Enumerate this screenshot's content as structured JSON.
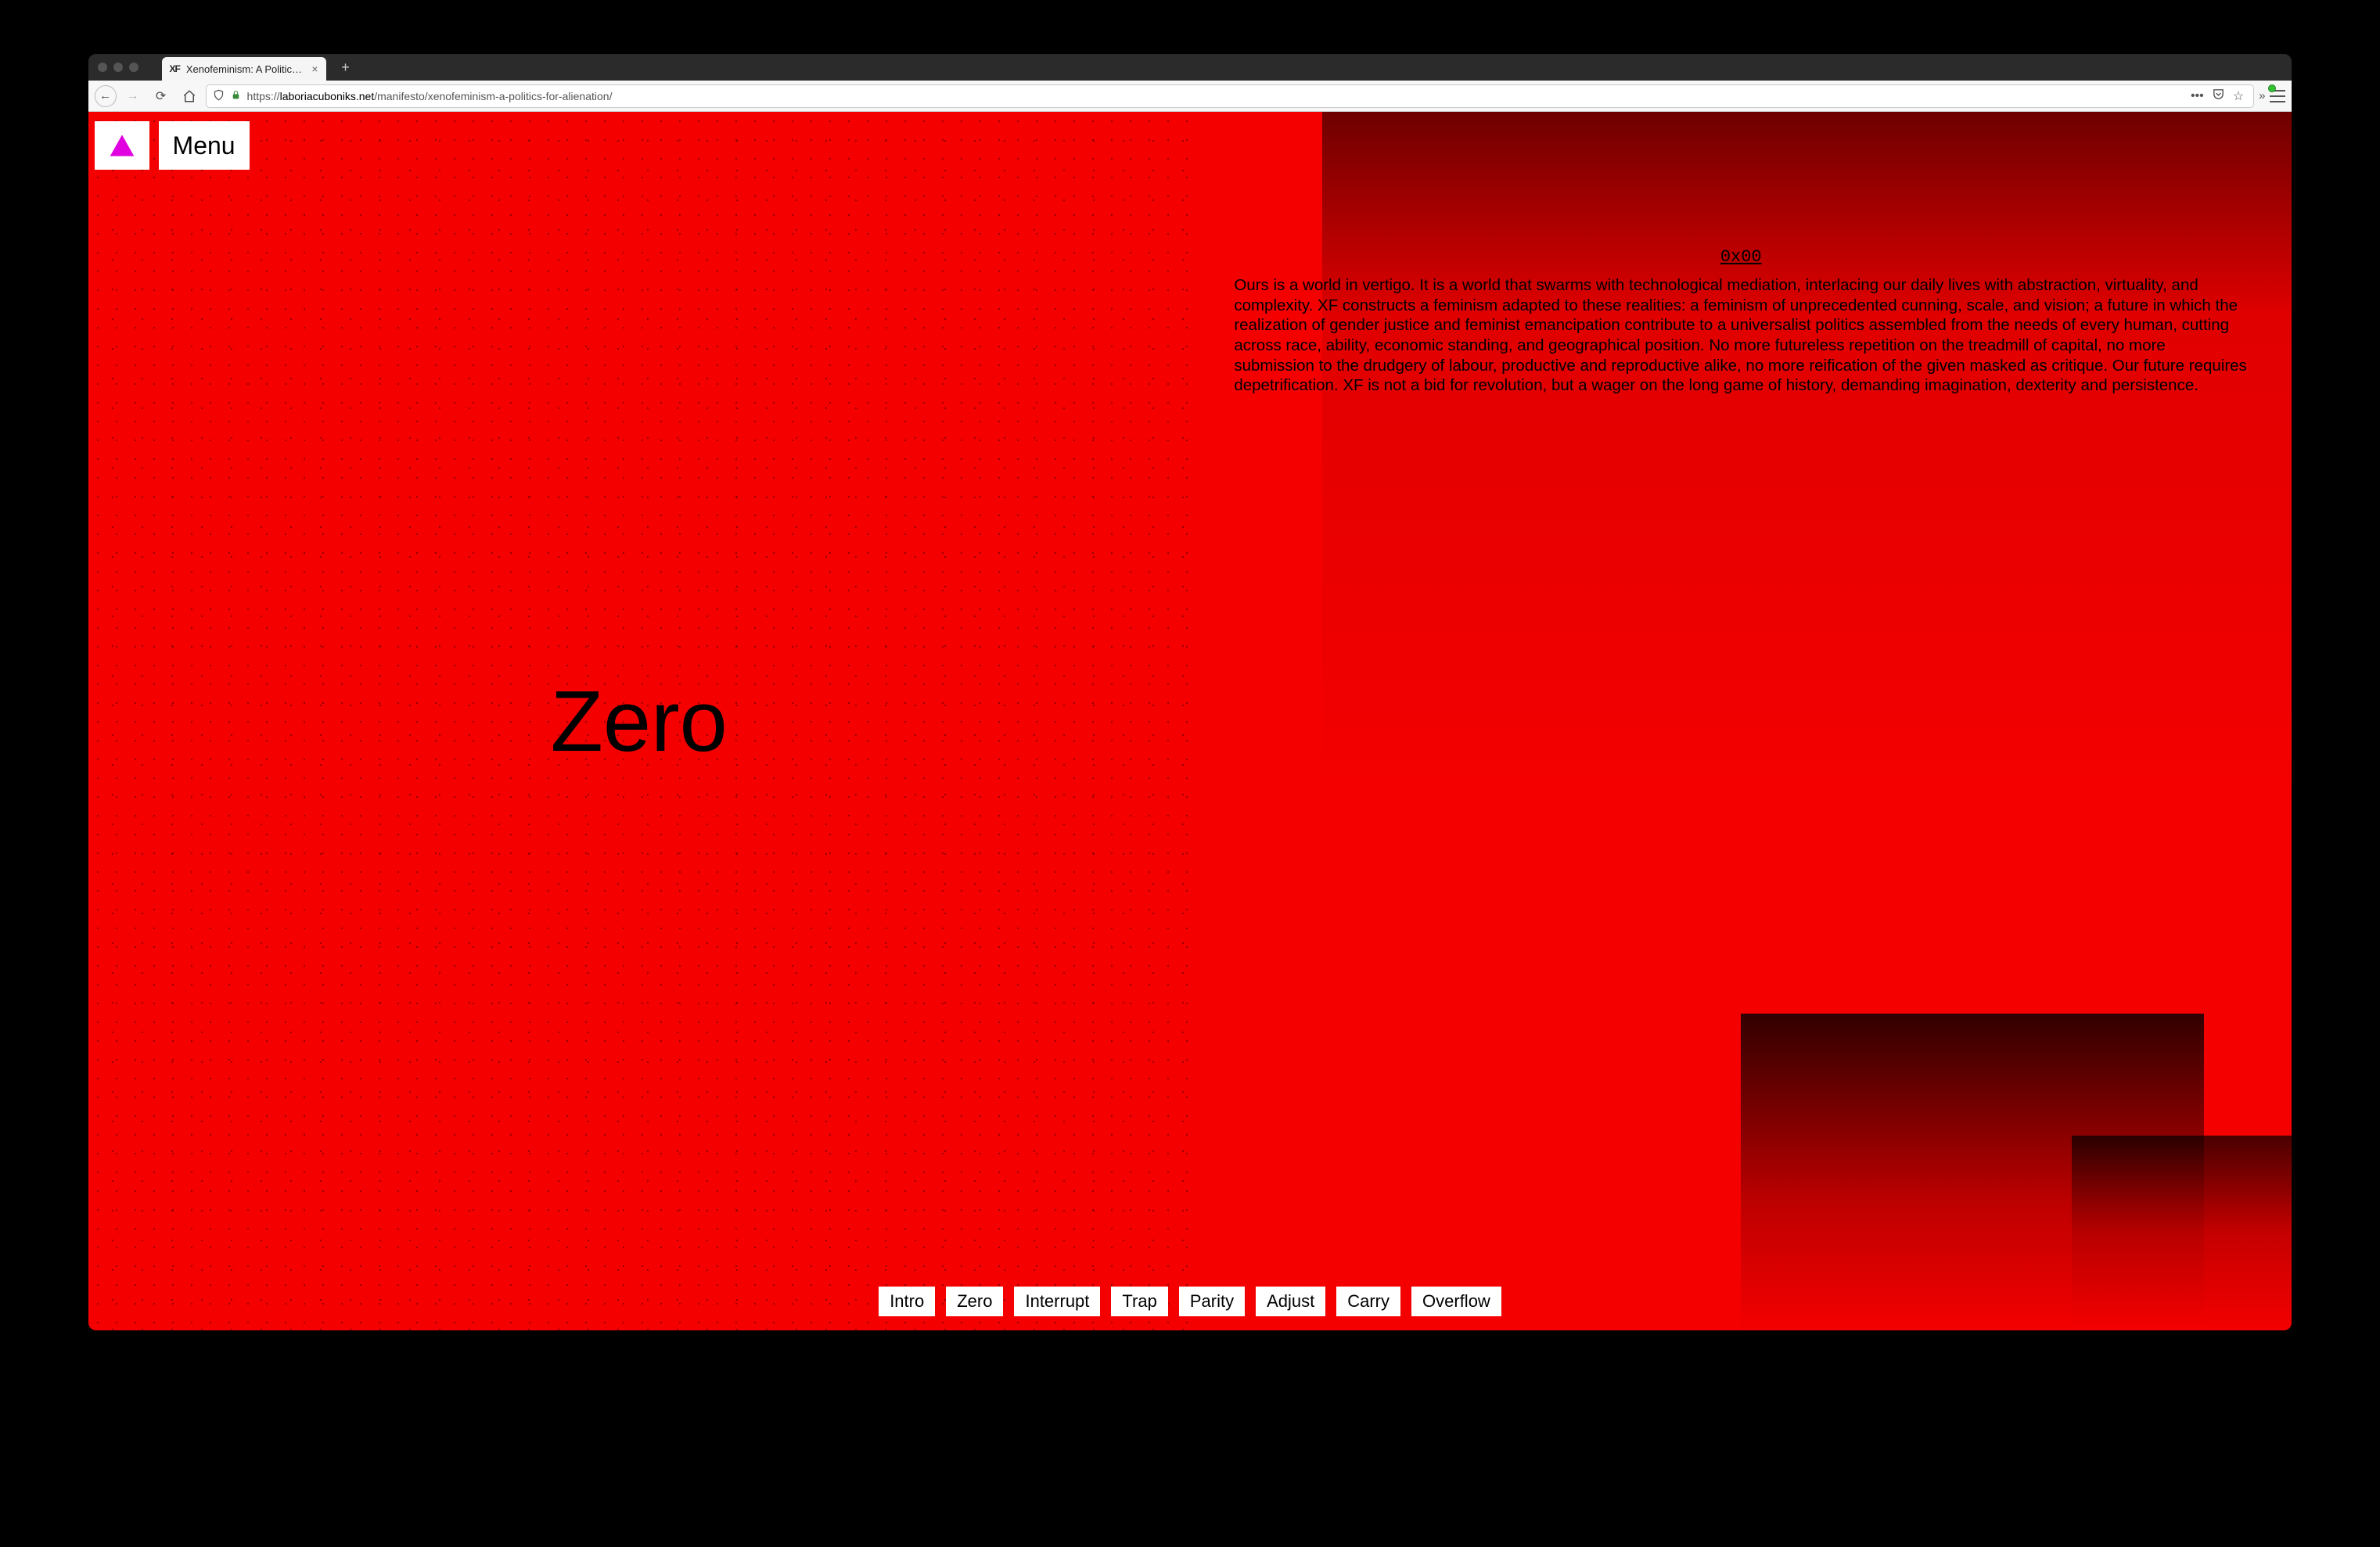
{
  "browser": {
    "tab": {
      "favicon": "XF",
      "title": "Xenofeminism: A Politics for Ali…"
    },
    "url_display_prefix": "https://",
    "url_display_domain": "laboriacuboniks.net",
    "url_display_path": "/manifesto/xenofeminism-a-politics-for-alienation/",
    "meatballs": "•••"
  },
  "page": {
    "menu_label": "Menu",
    "section_heading": "Zero",
    "hex_label": "0x00",
    "body_text": "Ours is a world in vertigo. It is a world that swarms with technological mediation, interlacing our daily lives with abstraction, virtuality, and complexity. XF constructs a feminism adapted to these realities: a feminism of unprecedented cunning, scale, and vision; a future in which the realization of gender justice and feminist emancipation contribute to a universalist politics assembled from the needs of every human, cutting across race, ability, economic standing, and geographical position. No more futureless repetition on the treadmill of capital, no more submission to the drudgery of labour, productive and reproductive alike, no more reification of the given masked as critique. Our future requires depetrification. XF is not a bid for revolution, but a wager on the long game of history, demanding imagination, dexterity and persistence.",
    "nav": [
      "Intro",
      "Zero",
      "Interrupt",
      "Trap",
      "Parity",
      "Adjust",
      "Carry",
      "Overflow"
    ]
  }
}
